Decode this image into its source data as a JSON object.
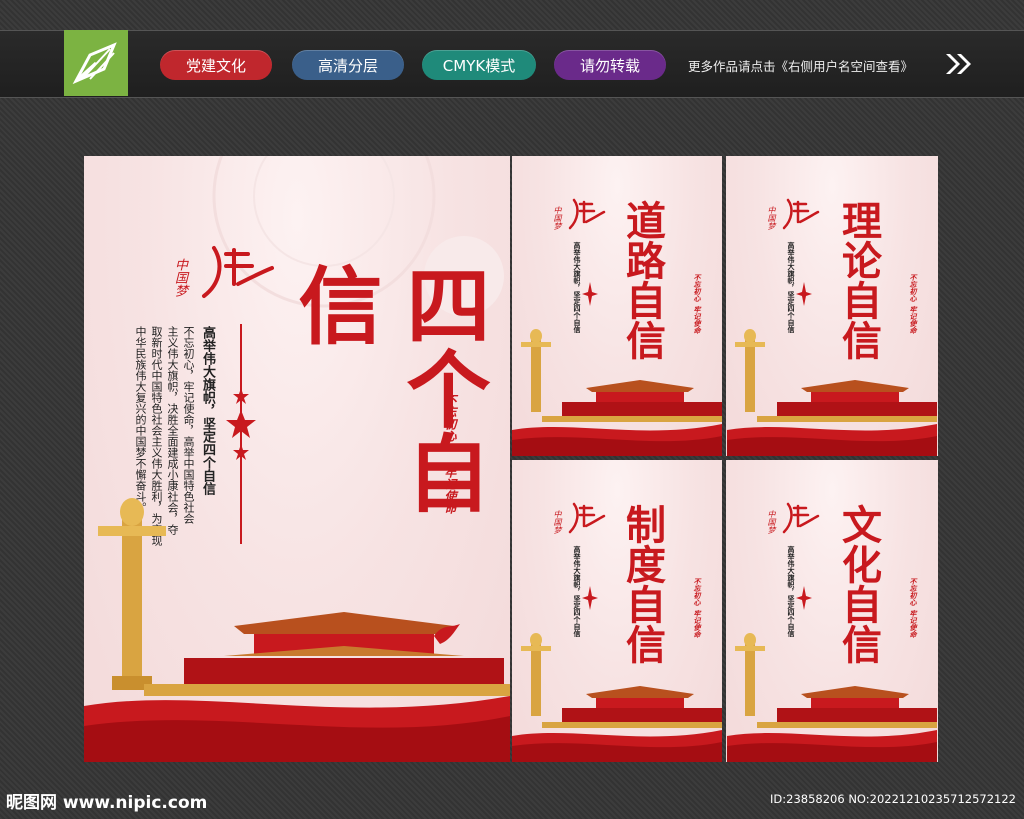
{
  "topbar": {
    "logo_icon": "pen-nib-icon",
    "tags": [
      {
        "label": "党建文化",
        "color": "#c0272d"
      },
      {
        "label": "高清分层",
        "color": "#3a5f8a"
      },
      {
        "label": "CMYK模式",
        "color": "#1f8a7a"
      },
      {
        "label": "请勿转载",
        "color": "#6a2a8a"
      }
    ],
    "note": "更多作品请点击《右侧用户名空间查看》"
  },
  "main_poster": {
    "title": "四个自信",
    "slogan": "高举伟大旗帜，坚定四个自信",
    "body": [
      "不忘初心，牢记使命，高举中国特色社会",
      "主义伟大旗帜，决胜全面建成小康社会，夺",
      "取新时代中国特色社会主义伟大胜利，为实现",
      "中华民族伟大复兴的中国梦不懈奋斗。"
    ],
    "stamp_left": "不忘初心",
    "stamp_right": "牢记使命",
    "logo_text": "中国梦"
  },
  "small_posters": [
    {
      "title": "道路自信",
      "slogan": "高举伟大旗帜，坚定四个自信",
      "stamp_left": "不忘初心",
      "stamp_right": "牢记使命",
      "logo_text": "中国梦"
    },
    {
      "title": "理论自信",
      "slogan": "高举伟大旗帜，坚定四个自信",
      "stamp_left": "不忘初心",
      "stamp_right": "牢记使命",
      "logo_text": "中国梦"
    },
    {
      "title": "制度自信",
      "slogan": "高举伟大旗帜，坚定四个自信",
      "stamp_left": "不忘初心",
      "stamp_right": "牢记使命",
      "logo_text": "中国梦"
    },
    {
      "title": "文化自信",
      "slogan": "高举伟大旗帜，坚定四个自信",
      "stamp_left": "不忘初心",
      "stamp_right": "牢记使命",
      "logo_text": "中国梦"
    }
  ],
  "footer": {
    "site": "昵图网 www.nipic.com",
    "id": "ID:23858206 NO:20221210235712572122"
  },
  "colors": {
    "primary_red": "#c8191e",
    "gold": "#d9a441"
  }
}
